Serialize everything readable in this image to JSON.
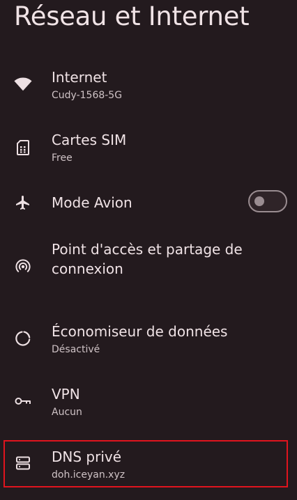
{
  "page": {
    "title": "Réseau et Internet"
  },
  "items": [
    {
      "id": "internet",
      "title": "Internet",
      "subtitle": "Cudy-1568-5G",
      "icon": "wifi-icon"
    },
    {
      "id": "sim",
      "title": "Cartes SIM",
      "subtitle": "Free",
      "icon": "sim-card-icon"
    },
    {
      "id": "airplane",
      "title": "Mode Avion",
      "icon": "airplane-icon",
      "toggle_on": false
    },
    {
      "id": "hotspot",
      "title": "Point d'accès et partage de connexion",
      "icon": "hotspot-icon"
    },
    {
      "id": "datasaver",
      "title": "Économiseur de données",
      "subtitle": "Désactivé",
      "icon": "data-saver-icon"
    },
    {
      "id": "vpn",
      "title": "VPN",
      "subtitle": "Aucun",
      "icon": "key-icon"
    },
    {
      "id": "dns",
      "title": "DNS privé",
      "subtitle": "doh.iceyan.xyz",
      "icon": "dns-server-icon",
      "highlighted": true
    }
  ],
  "colors": {
    "background": "#231a1e",
    "text": "#f0e3e6",
    "subtext": "#cfc3c6",
    "highlight_border": "#e0141e"
  }
}
